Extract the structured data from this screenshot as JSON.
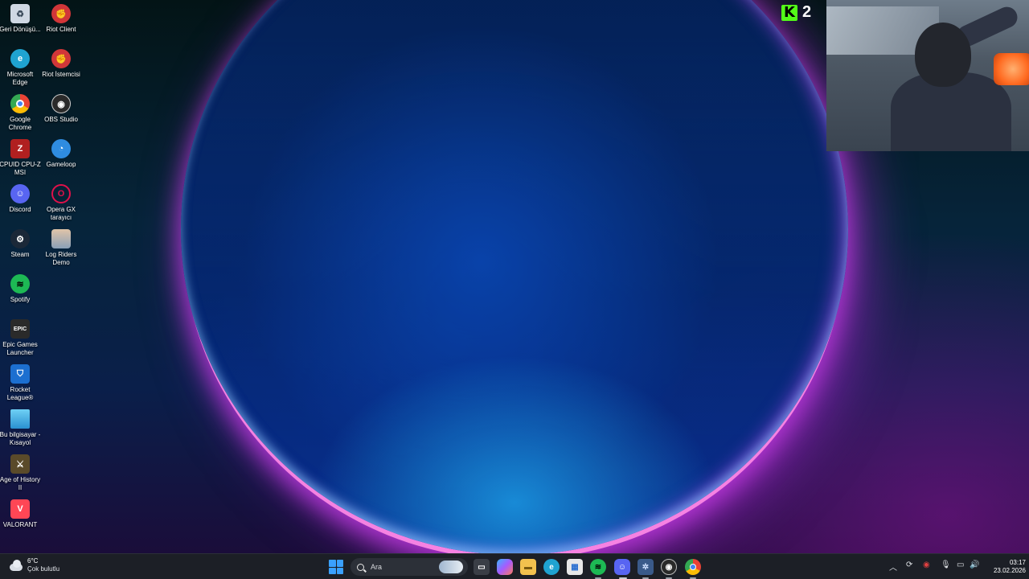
{
  "desktop": {
    "icons": [
      {
        "label": "Geri Dönüşü...",
        "icon": "recycle-bin-icon",
        "color": "#cfd8e3"
      },
      {
        "label": "Riot Client",
        "icon": "riot-client-icon",
        "color": "#d13639"
      },
      {
        "label": "Microsoft Edge",
        "icon": "edge-icon",
        "color": "#1fa3d1"
      },
      {
        "label": "Riot İstemcisi",
        "icon": "riot-client-icon",
        "color": "#d13639"
      },
      {
        "label": "Google Chrome",
        "icon": "chrome-icon",
        "color": "#e74c3c"
      },
      {
        "label": "OBS Studio",
        "icon": "obs-icon",
        "color": "#2a2a2a"
      },
      {
        "label": "CPUID CPU-Z MSI",
        "icon": "cpuz-icon",
        "color": "#b02020"
      },
      {
        "label": "Gameloop",
        "icon": "gameloop-icon",
        "color": "#2f8ce0"
      },
      {
        "label": "Discord",
        "icon": "discord-icon",
        "color": "#5865f2"
      },
      {
        "label": "Opera GX tarayıcı",
        "icon": "opera-gx-icon",
        "color": "#e0114a"
      },
      {
        "label": "Steam",
        "icon": "steam-icon",
        "color": "#1b2838"
      },
      {
        "label": "Log Riders Demo",
        "icon": "log-riders-icon",
        "color": "#8aa0b8"
      },
      {
        "label": "Spotify",
        "icon": "spotify-icon",
        "color": "#1db954"
      },
      {
        "label": "Epic Games Launcher",
        "icon": "epic-games-icon",
        "color": "#2a2a2a"
      },
      {
        "label": "Rocket League®",
        "icon": "rocket-league-icon",
        "color": "#1c6fd0"
      },
      {
        "label": "Bu bilgisayar - Kısayol",
        "icon": "this-pc-icon",
        "color": "#3ab0e0"
      },
      {
        "label": "Age of History II",
        "icon": "age-of-history-icon",
        "color": "#5a4a2a"
      },
      {
        "label": "VALORANT",
        "icon": "valorant-icon",
        "color": "#ff4655"
      }
    ]
  },
  "stream": {
    "viewer_count": "2",
    "kick_brand_color": "#53fc18"
  },
  "taskbar": {
    "weather": {
      "temp": "6°C",
      "condition": "Çok bulutlu"
    },
    "search_placeholder": "Ara",
    "apps": [
      {
        "name": "task-view-icon",
        "color": "#cfd3d8"
      },
      {
        "name": "copilot-icon",
        "color": "#7c5cff"
      },
      {
        "name": "file-explorer-icon",
        "color": "#f2c14e"
      },
      {
        "name": "edge-icon",
        "color": "#1fa3d1"
      },
      {
        "name": "microsoft-store-icon",
        "color": "#e8e8e8"
      },
      {
        "name": "spotify-icon",
        "color": "#1db954"
      },
      {
        "name": "discord-icon",
        "color": "#5865f2"
      },
      {
        "name": "settings-app-icon",
        "color": "#6aa0d8"
      },
      {
        "name": "obs-icon",
        "color": "#2a2a2a"
      },
      {
        "name": "chrome-icon",
        "color": "#e74c3c"
      }
    ],
    "clock": {
      "time": "03:17",
      "date": "23.02.2026"
    }
  }
}
